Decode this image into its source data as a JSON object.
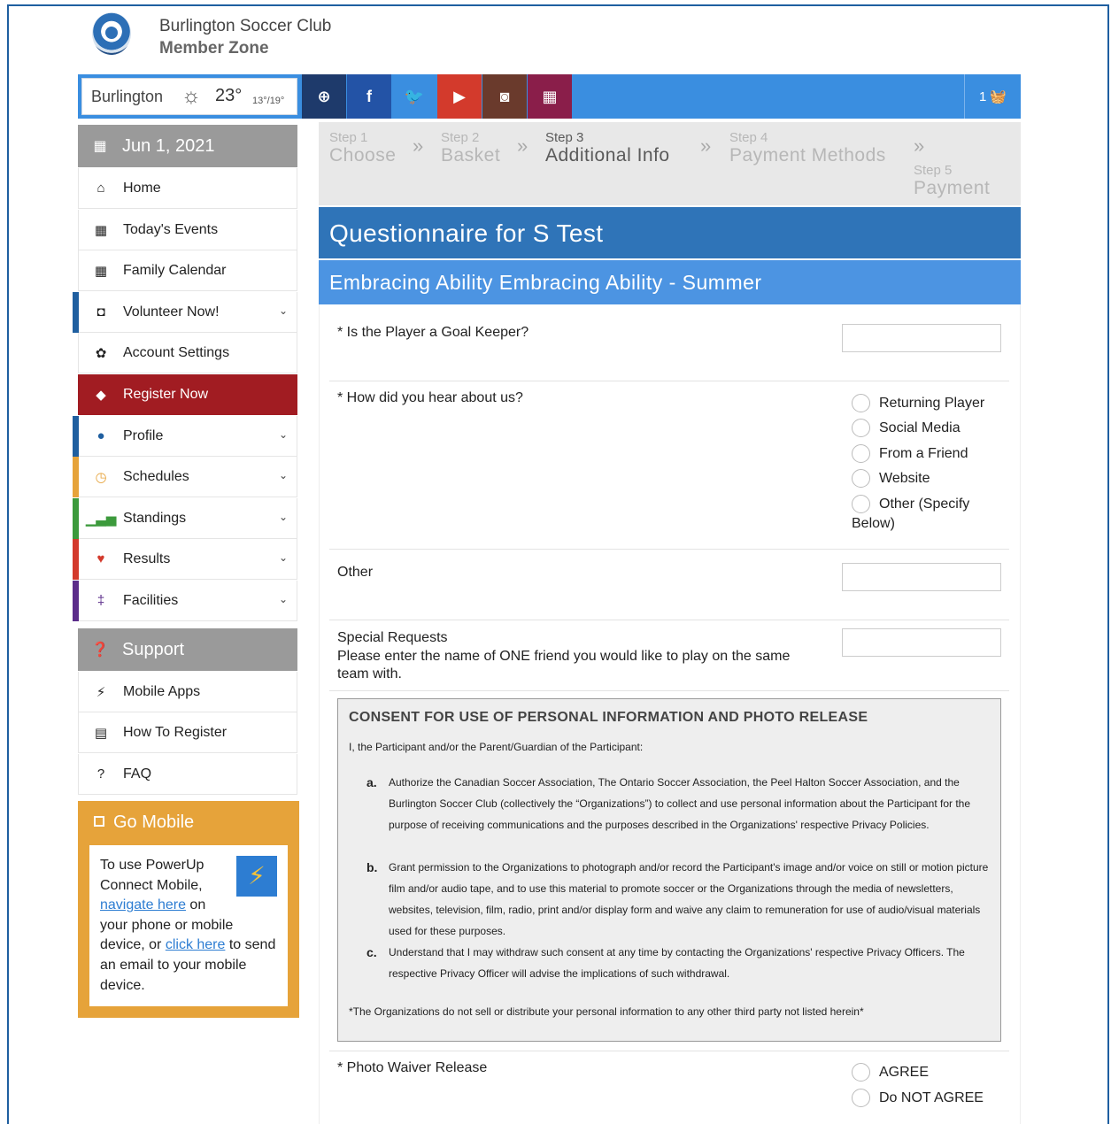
{
  "header": {
    "club_name": "Burlington Soccer Club",
    "zone_name": "Member Zone"
  },
  "weather": {
    "city": "Burlington",
    "icon": "sun-icon",
    "temp": "23°",
    "range": "13°/19°"
  },
  "social": [
    {
      "name": "globe-icon",
      "glyph": "⊕",
      "color": "#1e3a6b"
    },
    {
      "name": "facebook-icon",
      "glyph": "f",
      "color": "#2353a6"
    },
    {
      "name": "twitter-icon",
      "glyph": "🐦",
      "color": "#3a8ee0"
    },
    {
      "name": "youtube-icon",
      "glyph": "▶",
      "color": "#d33a2c"
    },
    {
      "name": "instagram-icon",
      "glyph": "◙",
      "color": "#6a3a2c"
    },
    {
      "name": "calendar-icon",
      "glyph": "▦",
      "color": "#8a1e4a"
    }
  ],
  "cart": {
    "count": "1",
    "icon": "basket-icon"
  },
  "sidebar": {
    "date": "Jun 1, 2021",
    "items": [
      {
        "label": "Home",
        "icon": "home-icon"
      },
      {
        "label": "Today's Events",
        "icon": "calendar-icon"
      },
      {
        "label": "Family Calendar",
        "icon": "calendar-icon"
      },
      {
        "label": "Volunteer Now!",
        "icon": "volunteer-icon"
      },
      {
        "label": "Account Settings",
        "icon": "gear-icon"
      },
      {
        "label": "Register Now",
        "icon": "tag-icon"
      },
      {
        "label": "Profile",
        "icon": "user-icon"
      },
      {
        "label": "Schedules",
        "icon": "clock-icon"
      },
      {
        "label": "Standings",
        "icon": "bar-chart-icon"
      },
      {
        "label": "Results",
        "icon": "trophy-icon"
      },
      {
        "label": "Facilities",
        "icon": "signpost-icon"
      }
    ],
    "support_title": "Support",
    "support_items": [
      {
        "label": "Mobile Apps",
        "icon": "bolt-icon"
      },
      {
        "label": "How To Register",
        "icon": "pdf-icon"
      },
      {
        "label": "FAQ",
        "icon": "question-icon"
      }
    ]
  },
  "gomobile": {
    "title": "Go Mobile",
    "text1": "To use PowerUp Connect Mobile,",
    "link1": "navigate here",
    "text2": "on your phone or mobile device, or",
    "link2": "click here",
    "text3": "to send an email to your mobile device."
  },
  "steps": [
    {
      "small": "Step 1",
      "big": "Choose"
    },
    {
      "small": "Step 2",
      "big": "Basket"
    },
    {
      "small": "Step 3",
      "big": "Additional Info"
    },
    {
      "small": "Step 4",
      "big": "Payment Methods"
    },
    {
      "small": "Step 5",
      "big": "Payment"
    }
  ],
  "form": {
    "title": "Questionnaire for S Test",
    "subtitle": "Embracing Ability Embracing Ability - Summer",
    "q_goalkeeper": "* Is the Player a Goal Keeper?",
    "q_hear": "* How did you hear about us?",
    "hear_options": [
      "Returning Player",
      "Social Media",
      "From a Friend",
      "Website",
      "Other (Specify"
    ],
    "hear_option_cont": "Below)",
    "q_other": "Other",
    "q_special": "Special Requests",
    "q_special_help": "Please enter the name of ONE friend you would like to play on the same team with.",
    "consent_title": "CONSENT FOR USE OF PERSONAL INFORMATION AND PHOTO RELEASE",
    "consent_intro": "I, the Participant and/or the Parent/Guardian of the Participant:",
    "consent_items": [
      {
        "letter": "a.",
        "text": "Authorize the Canadian Soccer Association, The Ontario Soccer Association, the Peel Halton Soccer Association, and the Burlington Soccer Club (collectively the “Organizations”) to collect and use personal information about the Participant for the purpose of receiving communications and the purposes described in the Organizations' respective Privacy Policies."
      },
      {
        "letter": "b.",
        "text": "Grant permission to the Organizations to photograph and/or record the Participant's image and/or voice on still or motion picture film and/or audio tape, and to use this material to promote soccer or the Organizations through the media of newsletters, websites, television, film, radio, print and/or display form and waive any claim to remuneration for use of audio/visual materials used for these purposes."
      },
      {
        "letter": "c.",
        "text": "Understand that I may withdraw such consent at any time by contacting the Organizations' respective Privacy Officers. The respective Privacy Officer will advise the implications of such withdrawal."
      }
    ],
    "consent_footer": "*The Organizations do not sell or distribute your personal information to any other third party not listed herein*",
    "q_photo": "* Photo Waiver Release",
    "photo_options": [
      "AGREE",
      "Do NOT AGREE"
    ]
  }
}
